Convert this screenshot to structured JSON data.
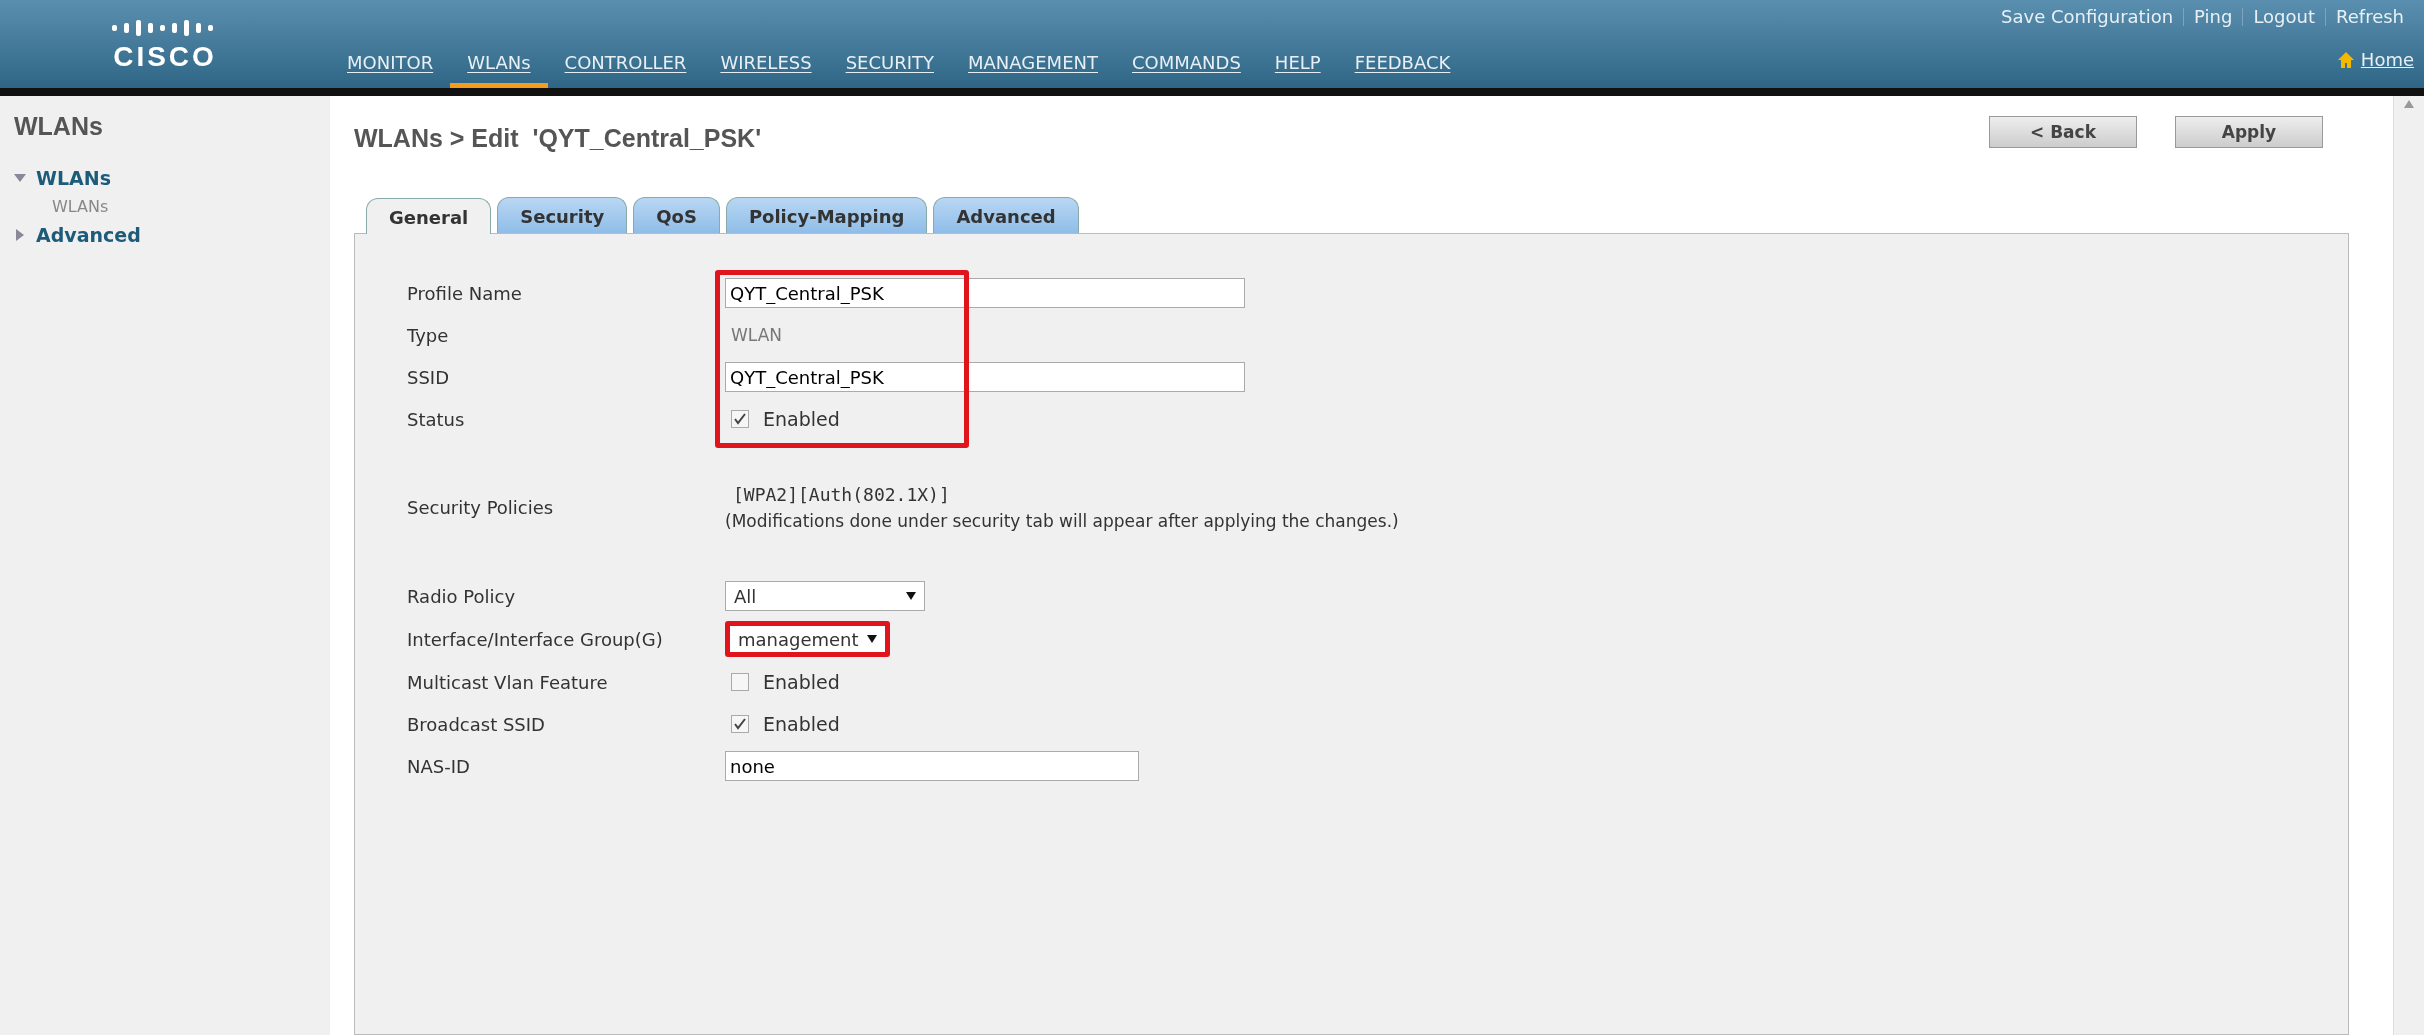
{
  "header": {
    "logo": "CISCO",
    "nav": [
      {
        "label": "MONITOR",
        "selected": false
      },
      {
        "label": "WLANs",
        "selected": true
      },
      {
        "label": "CONTROLLER",
        "selected": false
      },
      {
        "label": "WIRELESS",
        "selected": false
      },
      {
        "label": "SECURITY",
        "selected": false
      },
      {
        "label": "MANAGEMENT",
        "selected": false
      },
      {
        "label": "COMMANDS",
        "selected": false
      },
      {
        "label": "HELP",
        "selected": false
      },
      {
        "label": "FEEDBACK",
        "selected": false
      }
    ],
    "links": [
      "Save Configuration",
      "Ping",
      "Logout",
      "Refresh"
    ],
    "home": "Home"
  },
  "sidebar": {
    "title": "WLANs",
    "items": [
      {
        "label": "WLANs",
        "expanded": true,
        "children": [
          {
            "label": "WLANs"
          }
        ]
      },
      {
        "label": "Advanced",
        "expanded": false
      }
    ]
  },
  "page": {
    "title": "WLANs > Edit  'QYT_Central_PSK'",
    "buttons": [
      "< Back",
      "Apply"
    ],
    "tabs": [
      {
        "label": "General",
        "selected": true
      },
      {
        "label": "Security",
        "selected": false
      },
      {
        "label": "QoS",
        "selected": false
      },
      {
        "label": "Policy-Mapping",
        "selected": false
      },
      {
        "label": "Advanced",
        "selected": false
      }
    ],
    "sections": [
      {
        "highlighted": true,
        "rows": [
          {
            "kind": "input",
            "label": "Profile Name",
            "value": "QYT_Central_PSK"
          },
          {
            "kind": "text",
            "label": "Type",
            "value": "WLAN"
          },
          {
            "kind": "input",
            "label": "SSID",
            "value": "QYT_Central_PSK"
          },
          {
            "kind": "checkbox",
            "label": "Status",
            "checked": true,
            "value": "Enabled"
          }
        ]
      },
      {
        "rows": [
          {
            "kind": "policies",
            "label": "Security Policies",
            "value": "[WPA2][Auth(802.1X)]",
            "note": "(Modifications done under security tab will appear after applying the changes.)"
          }
        ]
      },
      {
        "rows": [
          {
            "kind": "select",
            "label": "Radio Policy",
            "value": "All",
            "highlighted": false
          },
          {
            "kind": "select",
            "label": "Interface/Interface Group(G)",
            "value": "management",
            "highlighted": true
          },
          {
            "kind": "checkbox",
            "label": "Multicast Vlan Feature",
            "checked": false,
            "value": "Enabled"
          },
          {
            "kind": "checkbox",
            "label": "Broadcast SSID",
            "checked": true,
            "value": "Enabled"
          },
          {
            "kind": "input",
            "label": "NAS-ID",
            "value": "none"
          }
        ]
      }
    ]
  }
}
